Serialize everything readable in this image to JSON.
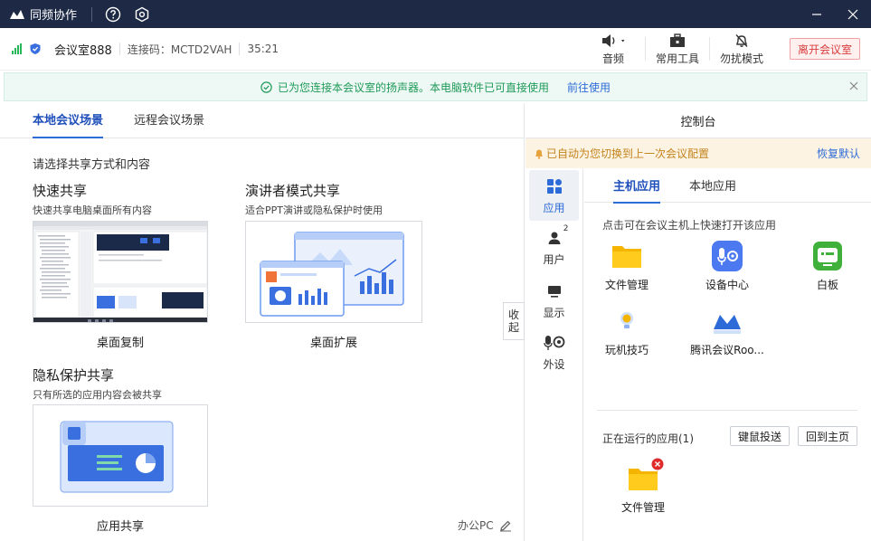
{
  "titlebar": {
    "app_name": "同频协作"
  },
  "header": {
    "room_name": "会议室888",
    "code_label": "连接码：MCTD2VAH",
    "duration": "35:21",
    "tools": {
      "audio": "音频",
      "tools": "常用工具",
      "dnd": "勿扰模式"
    },
    "leave": "离开会议室"
  },
  "notice": {
    "text": "已为您连接本会议室的扬声器。本电脑软件已可直接使用",
    "link": "前往使用"
  },
  "left": {
    "tabs": [
      "本地会议场景",
      "远程会议场景"
    ],
    "prompt": "请选择共享方式和内容",
    "quick": {
      "title": "快速共享",
      "desc": "快速共享电脑桌面所有内容",
      "thumb_label": "桌面复制"
    },
    "presenter": {
      "title": "演讲者模式共享",
      "desc": "适合PPT演讲或隐私保护时使用",
      "thumb_label": "桌面扩展"
    },
    "privacy": {
      "title": "隐私保护共享",
      "desc": "只有所选的应用内容会被共享",
      "thumb_label": "应用共享"
    },
    "collapse": [
      "收",
      "起"
    ],
    "office": "办公PC"
  },
  "right": {
    "title": "控制台",
    "warn": "已自动为您切换到上一次会议配置",
    "restore": "恢复默认",
    "sidebar": [
      {
        "label": "应用",
        "badge": ""
      },
      {
        "label": "用户",
        "badge": "2"
      },
      {
        "label": "显示",
        "badge": ""
      },
      {
        "label": "外设",
        "badge": ""
      }
    ],
    "tabs": [
      "主机应用",
      "本地应用"
    ],
    "hint": "点击可在会议主机上快速打开该应用",
    "apps": [
      "文件管理",
      "设备中心",
      "白板",
      "玩机技巧",
      "腾讯会议Roo..."
    ],
    "running_label": "正在运行的应用(1)",
    "btn_kvm": "键鼠投送",
    "btn_home": "回到主页",
    "running_app": "文件管理"
  },
  "colors": {
    "accent": "#2d6bd8",
    "titlebar": "#1e2a45",
    "danger": "#d83b3b",
    "success": "#1f9a59"
  }
}
